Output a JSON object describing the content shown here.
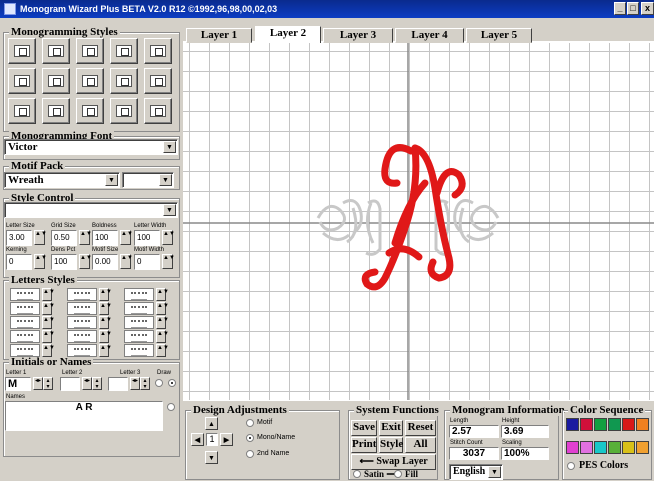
{
  "app": {
    "title": "Monogram Wizard Plus BETA V2.0 R12 ©1992,96,98,00,02,03"
  },
  "window_buttons": {
    "minimize": "_",
    "maximize": "□",
    "close": "x"
  },
  "panel": {
    "monogramming_styles": "Monogramming Styles",
    "monogramming_font": "Monogramming Font",
    "font_value": "Victor",
    "motif_pack": "Motif Pack",
    "motif_value": "Wreath",
    "motif_value2": "",
    "style_control": "Style Control",
    "style_value": "",
    "params": [
      {
        "label": "Letter Size",
        "value": "3.00"
      },
      {
        "label": "Grid Size",
        "value": "0.50"
      },
      {
        "label": "Boldness",
        "value": "100"
      },
      {
        "label": "Letter Width",
        "value": "100"
      }
    ],
    "params2": [
      {
        "label": "Kerning",
        "value": "0"
      },
      {
        "label": "Dens Pct",
        "value": "100"
      },
      {
        "label": "Motif Size",
        "value": "0.00"
      },
      {
        "label": "Motif Width",
        "value": "0"
      }
    ],
    "letters_styles": "Letters Styles",
    "initials": "Initials or Names",
    "letter_labels": [
      "Letter 1",
      "Letter 2",
      "Letter 3",
      "Draw"
    ],
    "letter_values": [
      "M",
      "",
      ""
    ],
    "names_label": "Names",
    "names_value": "A R"
  },
  "tabs": [
    "Layer 1",
    "Layer 2",
    "Layer 3",
    "Layer 4",
    "Layer 5"
  ],
  "active_tab": "Layer 2",
  "design_adjustments": {
    "title": "Design Adjustments",
    "motif": "Motif",
    "mononame": "Mono/Name",
    "second_name": "2nd Name",
    "counter": "1"
  },
  "system_functions": {
    "title": "System Functions",
    "save": "Save",
    "exit": "Exit",
    "reset": "Reset",
    "print": "Print",
    "style": "Style",
    "all": "All",
    "swap": "Swap Layer",
    "satin": "Satin",
    "fill": "Fill"
  },
  "monogram_info": {
    "title": "Monogram Information",
    "length_label": "Length",
    "length": "2.57",
    "height_label": "Height",
    "height": "3.69",
    "stitch_label": "Stitch Count",
    "stitch": "3037",
    "scaling_label": "Scaling",
    "scaling": "100%",
    "language": "English"
  },
  "color_sequence": {
    "title": "Color Sequence",
    "pes": "PES Colors",
    "row1": [
      "#1a1aa0",
      "#d0103a",
      "#12a040",
      "#109850",
      "#d81818",
      "#f08020"
    ],
    "row2": [
      "#e040d0",
      "#e070e0",
      "#18c8c8",
      "#58b038",
      "#d8c018",
      "#f0a030"
    ]
  }
}
